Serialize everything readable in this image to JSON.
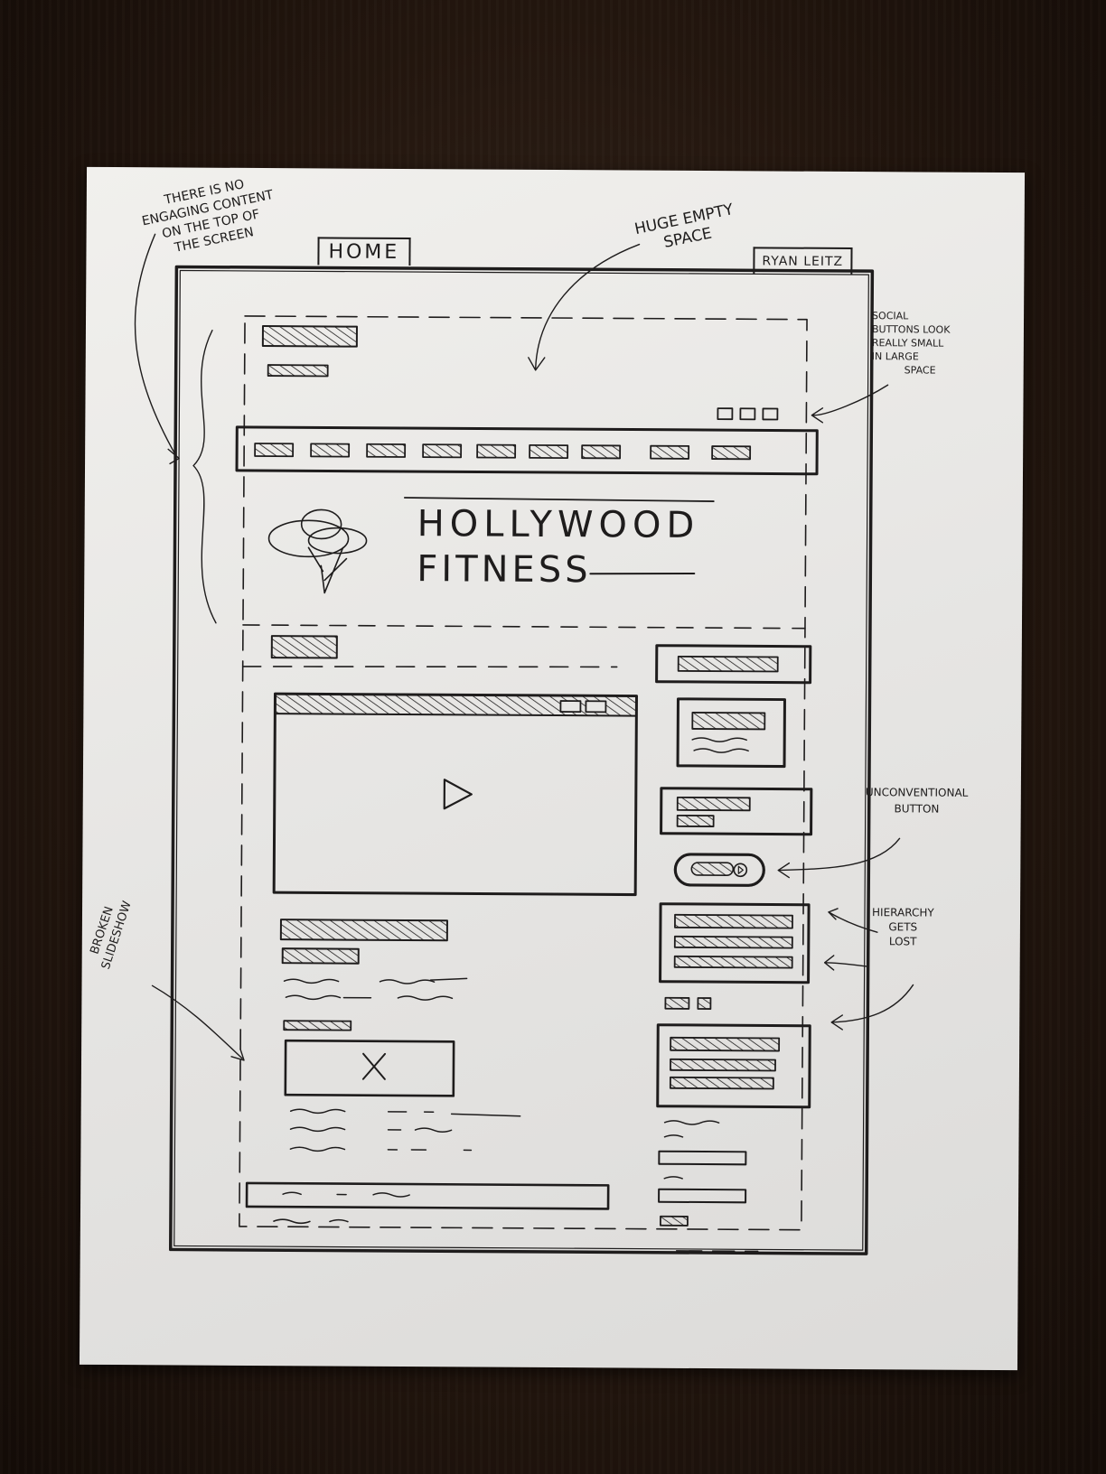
{
  "tabs": {
    "home": "HOME",
    "user": "RYAN LEITZ"
  },
  "brand": {
    "line1": "HOLLYWOOD",
    "line2": "FITNESS"
  },
  "annotations": {
    "no_content": [
      "THERE IS NO",
      "ENGAGING CONTENT",
      "ON THE TOP OF",
      "THE SCREEN"
    ],
    "empty_space": [
      "HUGE EMPTY",
      "SPACE"
    ],
    "social": [
      "SOCIAL",
      "BUTTONS LOOK",
      "REALLY SMALL",
      "IN LARGE",
      "SPACE"
    ],
    "button": [
      "UNCONVENTIONAL",
      "BUTTON"
    ],
    "hierarchy": [
      "HIERARCHY",
      "GETS",
      "LOST"
    ],
    "slideshow": [
      "BROKEN",
      "SLIDESHOW"
    ]
  },
  "icons": {
    "play": "play-icon",
    "broken_image": "broken-image-icon",
    "social": "social-icons",
    "logo": "tree-logo"
  },
  "colors": {
    "ink": "#1e1c1c",
    "paper": "#e8e7e5",
    "table": "#24170f"
  }
}
